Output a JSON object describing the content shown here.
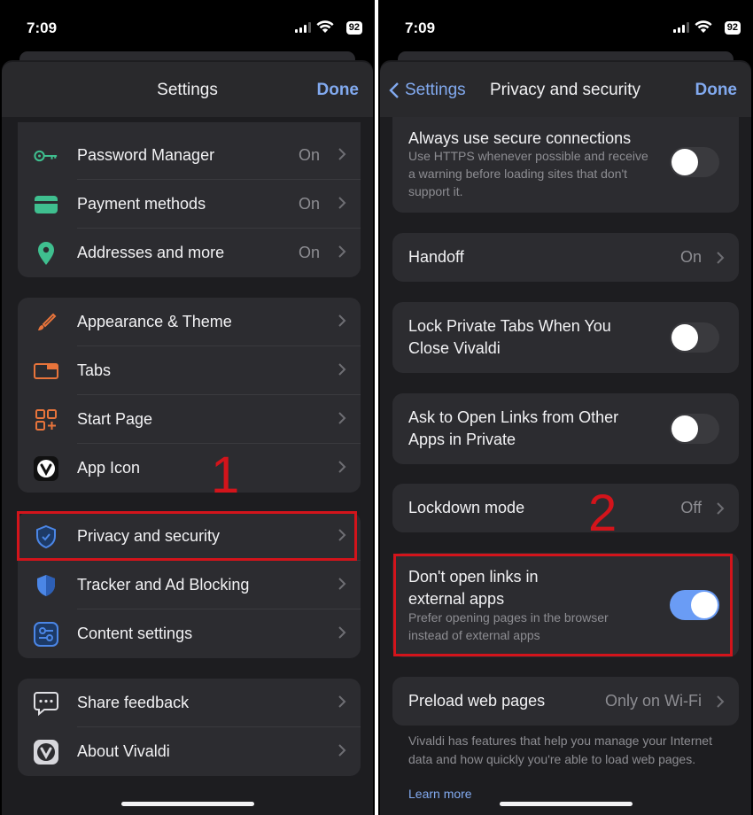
{
  "left": {
    "status": {
      "time": "7:09",
      "battery": "92"
    },
    "nav": {
      "title": "Settings",
      "done": "Done"
    },
    "group1": [
      {
        "icon": "key-icon",
        "label": "Password Manager",
        "value": "On"
      },
      {
        "icon": "credit-card-icon",
        "label": "Payment methods",
        "value": "On"
      },
      {
        "icon": "location-pin-icon",
        "label": "Addresses and more",
        "value": "On"
      }
    ],
    "group2": [
      {
        "icon": "paintbrush-icon",
        "label": "Appearance & Theme"
      },
      {
        "icon": "tabs-icon",
        "label": "Tabs"
      },
      {
        "icon": "start-page-grid-icon",
        "label": "Start Page"
      },
      {
        "icon": "vivaldi-logo-icon",
        "label": "App Icon"
      }
    ],
    "group3": [
      {
        "icon": "shield-check-icon",
        "label": "Privacy and security"
      },
      {
        "icon": "shield-blocker-icon",
        "label": "Tracker and Ad Blocking"
      },
      {
        "icon": "sliders-icon",
        "label": "Content settings"
      }
    ],
    "group4": [
      {
        "icon": "speech-bubble-icon",
        "label": "Share feedback"
      },
      {
        "icon": "vivaldi-logo-icon",
        "label": "About Vivaldi"
      }
    ],
    "annotation": "1"
  },
  "right": {
    "status": {
      "time": "7:09",
      "battery": "92"
    },
    "nav": {
      "back": "Settings",
      "title": "Privacy and security",
      "done": "Done"
    },
    "secure": {
      "title": "Always use secure connections",
      "subtitle": "Use HTTPS whenever possible and receive a warning before loading sites that don't support it.",
      "enabled": false
    },
    "handoff": {
      "title": "Handoff",
      "value": "On"
    },
    "lock_tabs": {
      "title": "Lock Private Tabs When You Close Vivaldi",
      "enabled": false
    },
    "ask_open": {
      "title": "Ask to Open Links from Other Apps in Private",
      "enabled": false
    },
    "lockdown": {
      "title": "Lockdown mode",
      "value": "Off"
    },
    "no_external": {
      "title": "Don't open links in external apps",
      "subtitle": "Prefer opening pages in the browser instead of external apps",
      "enabled": true
    },
    "preload": {
      "title": "Preload web pages",
      "value": "Only on Wi-Fi"
    },
    "footer": {
      "text": "Vivaldi has features that help you manage your Internet data and how quickly you're able to load web pages.",
      "link": "Learn more"
    },
    "annotation": "2"
  },
  "colors": {
    "accent": "#82aaf0",
    "highlight": "#d3141b",
    "toggle_on": "#6a9cf5"
  }
}
